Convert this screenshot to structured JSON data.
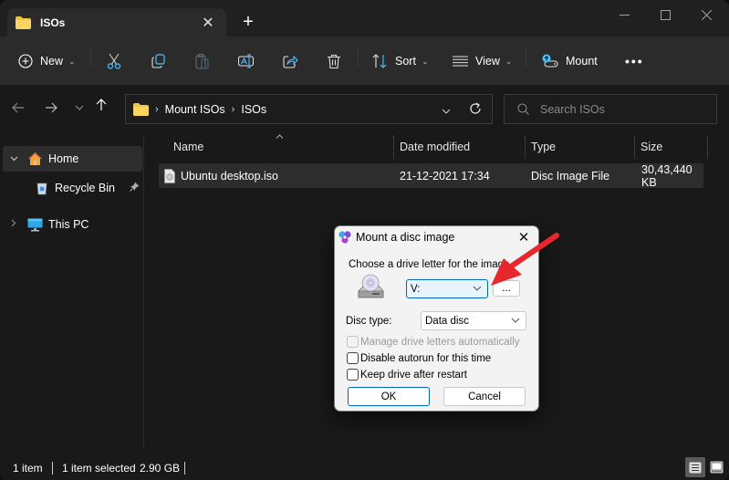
{
  "tab": {
    "title": "ISOs",
    "close_icon": "close-icon",
    "new_tab_icon": "plus-icon"
  },
  "window_controls": {
    "minimize": "minimize-icon",
    "maximize": "maximize-icon",
    "close": "close-icon"
  },
  "toolbar": {
    "new_label": "New",
    "cut": "cut-icon",
    "copy": "copy-icon",
    "paste": "paste-icon",
    "rename": "rename-icon",
    "share": "share-icon",
    "delete": "delete-icon",
    "sort_label": "Sort",
    "view_label": "View",
    "mount_label": "Mount",
    "more": "more-icon"
  },
  "navigation": {
    "back": "back-arrow-icon",
    "forward": "forward-arrow-icon",
    "recent": "chevron-down-icon",
    "up": "up-arrow-icon"
  },
  "address_bar": {
    "breadcrumbs": [
      "Mount ISOs",
      "ISOs"
    ],
    "refresh": "refresh-icon"
  },
  "search": {
    "placeholder": "Search ISOs"
  },
  "sidebar": {
    "items": [
      {
        "label": "Home",
        "icon": "home-icon",
        "expanded": true,
        "selected": true
      },
      {
        "label": "Recycle Bin",
        "icon": "recycle-bin-icon",
        "pinned": true
      },
      {
        "label": "This PC",
        "icon": "pc-icon",
        "expanded": false
      }
    ]
  },
  "file_list": {
    "columns": [
      "Name",
      "Date modified",
      "Type",
      "Size"
    ],
    "sorted_by": "Name",
    "rows": [
      {
        "name": "Ubuntu desktop.iso",
        "date_modified": "21-12-2021 17:34",
        "type": "Disc Image File",
        "size": "30,43,440 KB",
        "selected": true
      }
    ]
  },
  "status_bar": {
    "item_count": "1 item",
    "selection": "1 item selected",
    "selection_size": "2.90 GB"
  },
  "dialog": {
    "title": "Mount a disc image",
    "drive_prompt": "Choose a drive letter for the image",
    "drive_letter": "V:",
    "browse_label": "...",
    "disc_type_label": "Disc type:",
    "disc_type": "Data disc",
    "options": [
      {
        "label": "Manage drive letters automatically",
        "checked": false,
        "disabled": true
      },
      {
        "label": "Disable autorun for this time",
        "checked": false,
        "disabled": false
      },
      {
        "label": "Keep drive after restart",
        "checked": false,
        "disabled": false
      }
    ],
    "ok_label": "OK",
    "cancel_label": "Cancel"
  },
  "annotation": {
    "arrow_color": "#e8262d"
  }
}
